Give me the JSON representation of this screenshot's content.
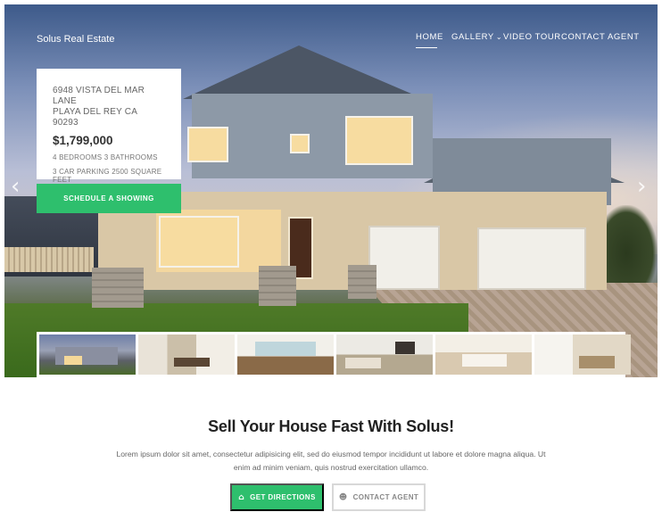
{
  "header": {
    "brand": "Solus Real Estate",
    "nav": [
      {
        "label": "HOME",
        "active": true
      },
      {
        "label": "GALLERY",
        "has_dropdown": true
      },
      {
        "label": "VIDEO TOUR"
      },
      {
        "label": "CONTACT AGENT"
      }
    ]
  },
  "listing": {
    "address_line1": "6948 VISTA DEL MAR LANE",
    "address_line2": "PLAYA DEL REY CA 90293",
    "price": "$1,799,000",
    "specs_line1": "4 BEDROOMS 3 BATHROOMS",
    "specs_line2": "3 CAR PARKING 2500 SQUARE FEET",
    "cta_label": "SCHEDULE A SHOWING"
  },
  "slider": {
    "prev_icon": "chevron-left-icon",
    "next_icon": "chevron-right-icon",
    "thumbnail_count": 6
  },
  "section": {
    "headline": "Sell Your House Fast With Solus!",
    "body": "Lorem ipsum dolor sit amet, consectetur adipisicing elit, sed do eiusmod tempor incididunt ut labore et dolore magna aliqua. Ut enim ad minim veniam, quis nostrud exercitation ullamco.",
    "directions_label": "GET DIRECTIONS",
    "directions_icon": "home-icon",
    "contact_label": "CONTACT AGENT",
    "contact_icon": "user-icon"
  },
  "colors": {
    "accent": "#2ebf6d",
    "text_dark": "#222222",
    "text_muted": "#666666"
  }
}
